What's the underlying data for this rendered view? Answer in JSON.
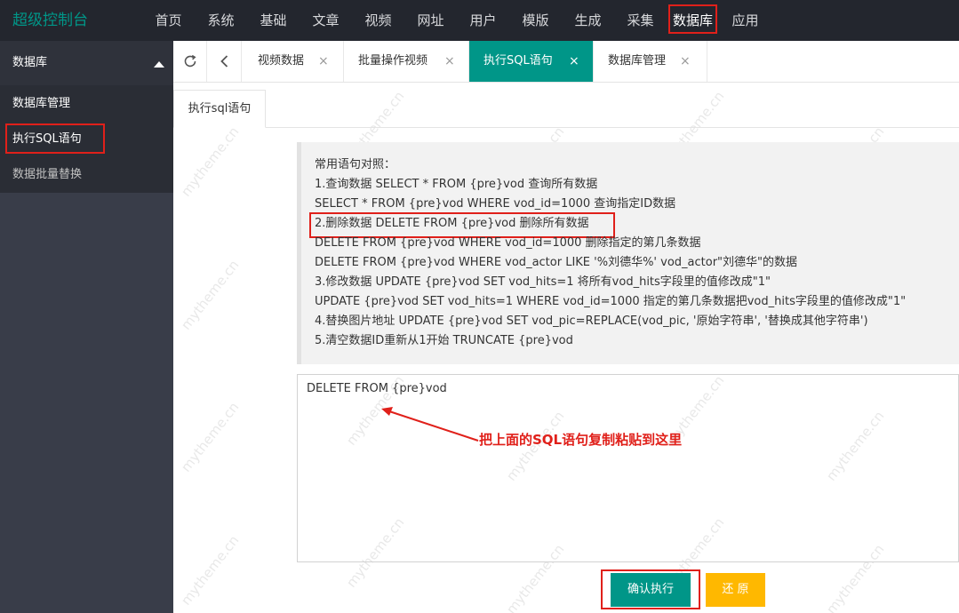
{
  "header": {
    "brand": "超级控制台",
    "nav": [
      "首页",
      "系统",
      "基础",
      "文章",
      "视频",
      "网址",
      "用户",
      "模版",
      "生成",
      "采集",
      "数据库",
      "应用"
    ],
    "active_nav": "数据库"
  },
  "sidebar": {
    "section": "数据库",
    "items": [
      "数据库管理",
      "执行SQL语句",
      "数据批量替换"
    ]
  },
  "tabs": {
    "items": [
      {
        "label": "视频数据",
        "close": "×"
      },
      {
        "label": "批量操作视频",
        "close": "×"
      },
      {
        "label": "执行SQL语句",
        "close": "×"
      },
      {
        "label": "数据库管理",
        "close": "×"
      }
    ],
    "active": "执行SQL语句"
  },
  "content": {
    "subtab": "执行sql语句",
    "tips": [
      "常用语句对照：",
      "1.查询数据 SELECT * FROM {pre}vod 查询所有数据",
      "SELECT * FROM {pre}vod WHERE vod_id=1000 查询指定ID数据",
      "2.删除数据 DELETE FROM {pre}vod 删除所有数据",
      "DELETE FROM {pre}vod WHERE vod_id=1000 删除指定的第几条数据",
      "DELETE FROM {pre}vod WHERE vod_actor LIKE '%刘德华%' vod_actor\"刘德华\"的数据",
      "3.修改数据 UPDATE {pre}vod SET vod_hits=1 将所有vod_hits字段里的值修改成\"1\"",
      "UPDATE {pre}vod SET vod_hits=1 WHERE vod_id=1000 指定的第几条数据把vod_hits字段里的值修改成\"1\"",
      "4.替换图片地址 UPDATE {pre}vod SET vod_pic=REPLACE(vod_pic, '原始字符串', '替换成其他字符串')",
      "5.清空数据ID重新从1开始 TRUNCATE {pre}vod"
    ],
    "sql_value": "DELETE FROM {pre}vod",
    "annotation": "把上面的SQL语句复制粘贴到这里",
    "watermark": "mytheme.cn",
    "exec_button": "确认执行",
    "reset_button": "还 原"
  },
  "colors": {
    "accent": "#009688",
    "warning": "#ffb800",
    "highlight": "#e0201a",
    "header_bg": "#23262e",
    "sidebar_bg": "#393d49"
  }
}
